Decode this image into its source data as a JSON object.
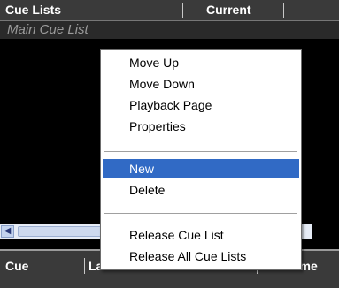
{
  "header": {
    "columns": [
      "Cue Lists",
      "Current"
    ]
  },
  "cue_list": {
    "name": "Main Cue List"
  },
  "bottom_header": {
    "columns": [
      "Cue",
      "Label",
      "Cue Time"
    ]
  },
  "scrollbar": {
    "left_arrow": "◀"
  },
  "context_menu": {
    "items": [
      "Move Up",
      "Move Down",
      "Playback Page",
      "Properties",
      "New",
      "Delete",
      "Release Cue List",
      "Release All Cue Lists"
    ],
    "highlighted": "New"
  },
  "colors": {
    "highlight": "#316ac5",
    "header_bg": "#3a3a3a",
    "list_bg": "#000000"
  }
}
